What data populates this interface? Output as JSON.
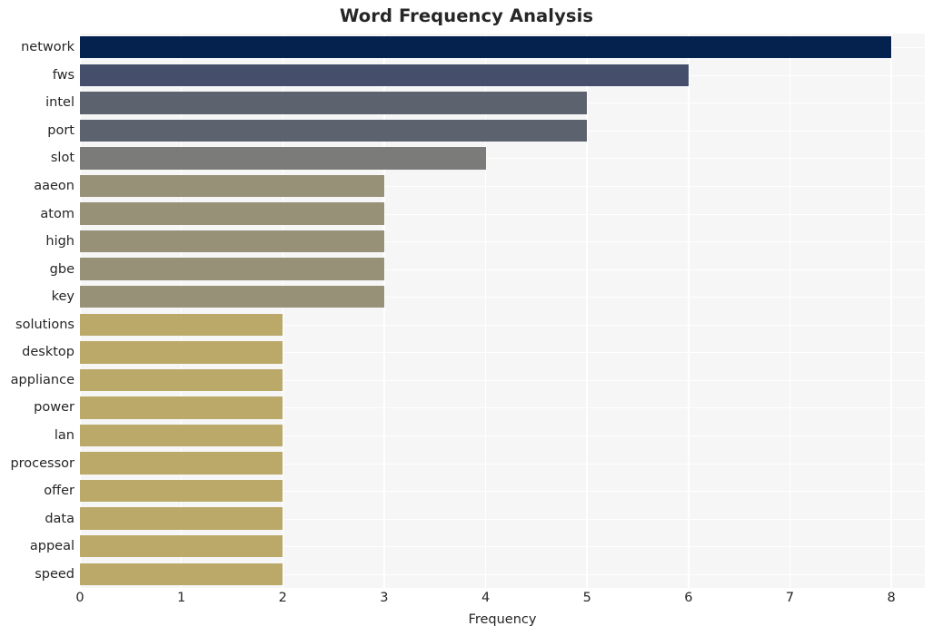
{
  "chart_data": {
    "type": "bar",
    "orientation": "horizontal",
    "title": "Word Frequency Analysis",
    "xlabel": "Frequency",
    "ylabel": "",
    "categories": [
      "network",
      "fws",
      "intel",
      "port",
      "slot",
      "aaeon",
      "atom",
      "high",
      "gbe",
      "key",
      "solutions",
      "desktop",
      "appliance",
      "power",
      "lan",
      "processor",
      "offer",
      "data",
      "appeal",
      "speed"
    ],
    "values": [
      8,
      6,
      5,
      5,
      4,
      3,
      3,
      3,
      3,
      3,
      2,
      2,
      2,
      2,
      2,
      2,
      2,
      2,
      2,
      2
    ],
    "bar_colors": [
      "#05224f",
      "#454f6c",
      "#5d626f",
      "#5d626f",
      "#7b7b7a",
      "#969177",
      "#969177",
      "#969177",
      "#969177",
      "#969177",
      "#bba96a",
      "#bba96a",
      "#bba96a",
      "#bba96a",
      "#bba96a",
      "#bba96a",
      "#bba96a",
      "#bba96a",
      "#bba96a",
      "#bba96a"
    ],
    "xlim": [
      0,
      8.33
    ],
    "xticks": [
      0,
      1,
      2,
      3,
      4,
      5,
      6,
      7,
      8
    ],
    "xtick_labels": [
      "0",
      "1",
      "2",
      "3",
      "4",
      "5",
      "6",
      "7",
      "8"
    ],
    "grid": "x-and-y-white-on-light",
    "legend": "none",
    "plot_background": "#f6f6f7",
    "figure_background": "#ffffff",
    "text_color": "#262626"
  }
}
